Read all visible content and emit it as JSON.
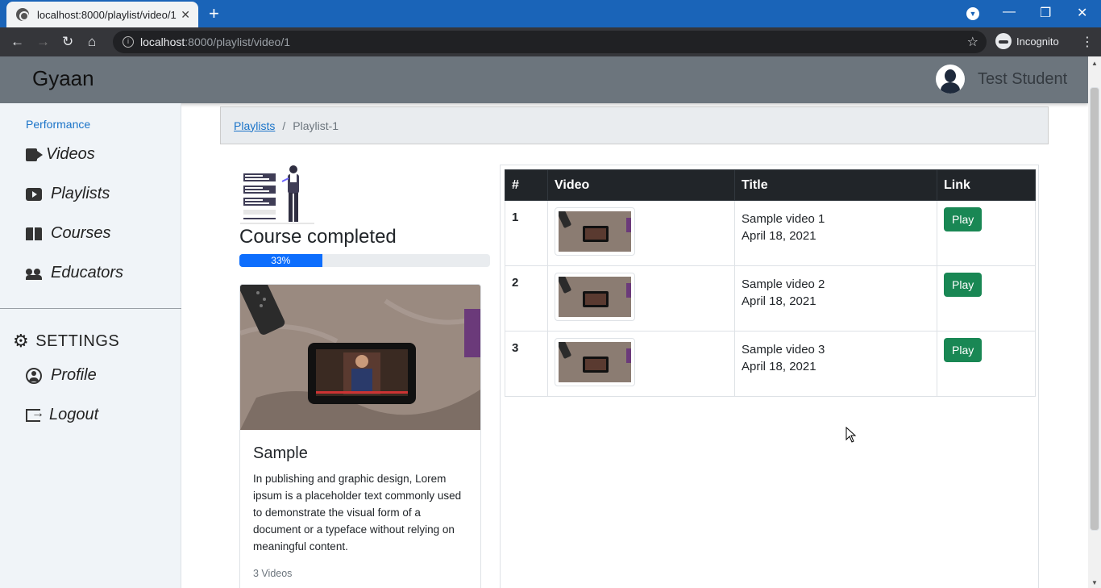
{
  "browser": {
    "tab_title": "localhost:8000/playlist/video/1",
    "url_host": "localhost",
    "url_path": ":8000/playlist/video/1",
    "incognito_label": "Incognito"
  },
  "navbar": {
    "brand": "Gyaan",
    "user_name": "Test Student"
  },
  "sidebar": {
    "section_title": "Performance",
    "items": [
      {
        "label": "Videos",
        "icon": "video-camera-icon"
      },
      {
        "label": "Playlists",
        "icon": "playlist-icon"
      },
      {
        "label": "Courses",
        "icon": "book-icon"
      },
      {
        "label": "Educators",
        "icon": "users-icon"
      }
    ],
    "settings_label": "SETTINGS",
    "settings_items": [
      {
        "label": "Profile",
        "icon": "profile-icon"
      },
      {
        "label": "Logout",
        "icon": "logout-icon"
      }
    ]
  },
  "breadcrumb": {
    "parent": "Playlists",
    "separator": "/",
    "current": "Playlist-1"
  },
  "progress": {
    "heading": "Course completed",
    "percent": 33,
    "percent_label": "33%"
  },
  "card": {
    "title": "Sample",
    "description": "In publishing and graphic design, Lorem ipsum is a placeholder text commonly used to demonstrate the visual form of a document or a typeface without relying on meaningful content.",
    "meta": "3 Videos"
  },
  "table": {
    "headers": [
      "#",
      "Video",
      "Title",
      "Link"
    ],
    "rows": [
      {
        "num": "1",
        "title": "Sample video 1",
        "date": "April 18, 2021",
        "button": "Play"
      },
      {
        "num": "2",
        "title": "Sample video 2",
        "date": "April 18, 2021",
        "button": "Play"
      },
      {
        "num": "3",
        "title": "Sample video 3",
        "date": "April 18, 2021",
        "button": "Play"
      }
    ]
  },
  "colors": {
    "accent": "#1a73c8",
    "navbar": "#6c757d",
    "play_button": "#198754",
    "progress": "#0d6efd"
  }
}
